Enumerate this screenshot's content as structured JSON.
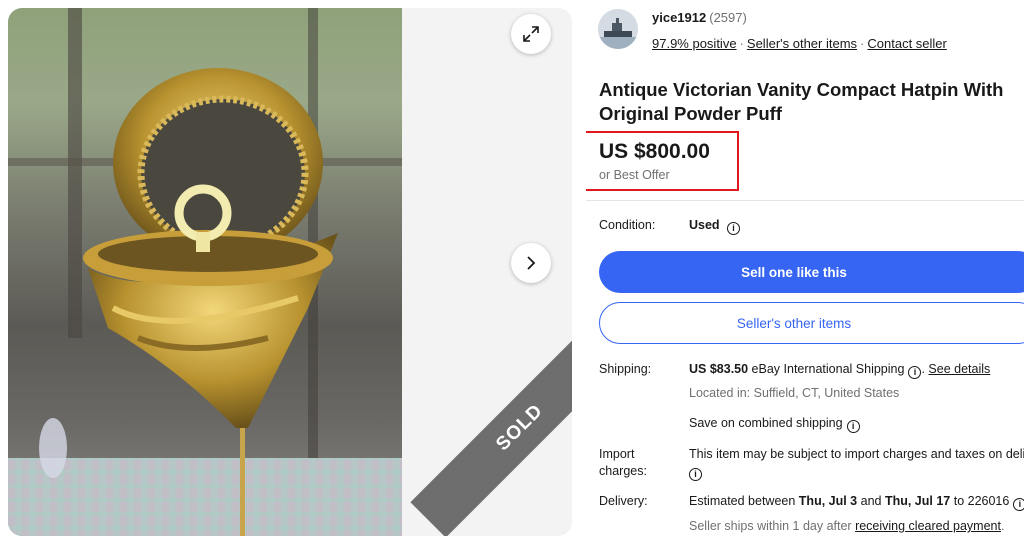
{
  "gallery": {
    "expand_icon": "expand-arrows-icon",
    "next_icon": "chevron-right-icon",
    "sold_ribbon": "SOLD"
  },
  "seller": {
    "name": "yice1912",
    "feedback_count": "(2597)",
    "positive": "97.9% positive",
    "other_items": "Seller's other items",
    "contact": "Contact seller"
  },
  "listing": {
    "title": "Antique Victorian Vanity Compact Hatpin With Original Powder Puff",
    "price": "US $800.00",
    "best_offer": "or Best Offer"
  },
  "condition": {
    "label": "Condition:",
    "value": "Used"
  },
  "actions": {
    "sell_one": "Sell one like this",
    "sellers_other_items": "Seller's other items"
  },
  "shipping": {
    "label": "Shipping:",
    "cost": "US $83.50",
    "method": " eBay International Shipping",
    "see_details": "See details",
    "location": "Located in: Suffield, CT, United States",
    "combined": "Save on combined shipping"
  },
  "import": {
    "label_line1": "Import",
    "label_line2": "charges:",
    "text": "This item may be subject to import charges and taxes on delivery."
  },
  "delivery": {
    "label": "Delivery:",
    "prefix": "Estimated between ",
    "date_from": "Thu, Jul 3",
    "and": " and ",
    "date_to": "Thu, Jul 17",
    "suffix": " to 226016",
    "ships_prefix": "Seller ships within 1 day after ",
    "ships_link": "receiving cleared payment",
    "ships_suffix": "."
  },
  "colors": {
    "primary_blue": "#3665f3",
    "highlight_red": "#e0191f",
    "sold_gray": "#6e6e6e"
  }
}
